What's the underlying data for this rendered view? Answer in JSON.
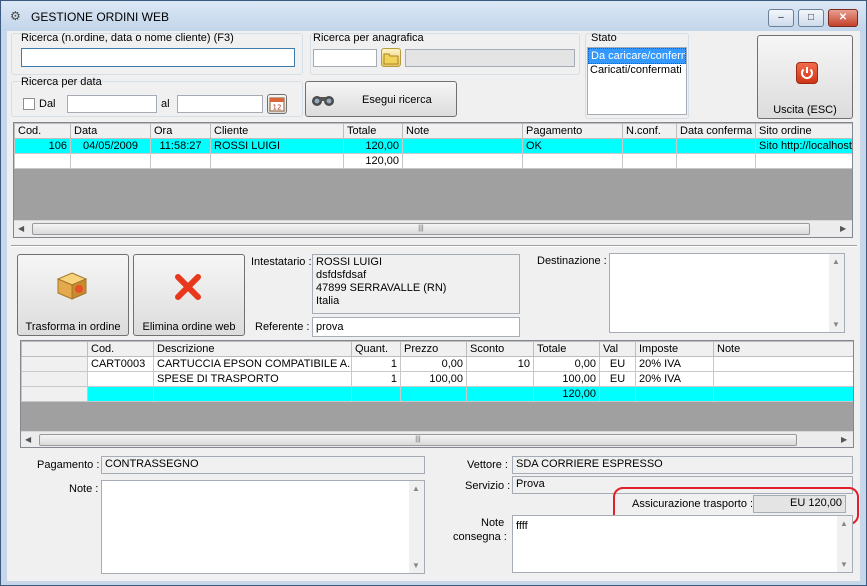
{
  "window": {
    "title": "GESTIONE ORDINI WEB",
    "minimize": "0",
    "maximize": "1",
    "close": "r"
  },
  "search": {
    "label": "Ricerca (n.ordine, data o nome cliente) (F3)",
    "value": ""
  },
  "anagrafica": {
    "label": "Ricerca per anagrafica",
    "code": "",
    "name": ""
  },
  "date_search": {
    "group_label": "Ricerca per data",
    "from_label": "Dal",
    "to_label": "al",
    "from": "",
    "to": "",
    "calendar_glyph": "12",
    "search_button": "Esegui ricerca"
  },
  "stato": {
    "label": "Stato",
    "options": [
      "Da caricare/confermare",
      "Caricati/confermati"
    ],
    "selected": "Da caricare/confermare"
  },
  "exit_button": "Uscita (ESC)",
  "orders": {
    "columns": [
      "Cod.",
      "Data",
      "Ora",
      "Cliente",
      "Totale",
      "Note",
      "Pagamento",
      "N.conf.",
      "Data conferma",
      "Sito ordine"
    ],
    "rows": [
      [
        "106",
        "04/05/2009",
        "11:58:27",
        "ROSSI LUIGI",
        "120,00",
        "",
        "OK",
        "",
        "",
        "Sito http://localhost"
      ],
      [
        "",
        "",
        "",
        "",
        "120,00",
        "",
        "",
        "",
        "",
        ""
      ]
    ]
  },
  "actions": {
    "transform": "Trasforma in ordine",
    "delete": "Elimina ordine web"
  },
  "customer": {
    "holder_label": "Intestatario :",
    "holder_lines": [
      "ROSSI LUIGI",
      "dsfdsfdsaf",
      "47899 SERRAVALLE (RN)",
      "Italia"
    ],
    "reference_label": "Referente :",
    "reference": "prova",
    "destination_label": "Destinazione :",
    "destination": ""
  },
  "lines": {
    "columns": [
      "",
      "Cod.",
      "Descrizione",
      "Quant.",
      "Prezzo",
      "Sconto",
      "Totale",
      "Val",
      "Imposte",
      "Note"
    ],
    "rows": [
      [
        "",
        "CART0003",
        "CARTUCCIA EPSON COMPATIBILE A...",
        "1",
        "0,00",
        "10",
        "0,00",
        "EU",
        "20% IVA",
        ""
      ],
      [
        "",
        "",
        "SPESE DI TRASPORTO",
        "1",
        "100,00",
        "",
        "100,00",
        "EU",
        "20% IVA",
        ""
      ],
      [
        "",
        "",
        "",
        "",
        "",
        "",
        "120,00",
        "",
        "",
        ""
      ]
    ]
  },
  "footer": {
    "payment_label": "Pagamento :",
    "payment": "CONTRASSEGNO",
    "notes_label": "Note :",
    "notes": "",
    "carrier_label": "Vettore :",
    "carrier": "SDA CORRIERE ESPRESSO",
    "service_label": "Servizio :",
    "service": "Prova",
    "insurance_label": "Assicurazione trasporto :",
    "insurance": "EU 120,00",
    "delivery_notes_label_1": "Note",
    "delivery_notes_label_2": "consegna :",
    "delivery_notes": "ffff"
  },
  "colors": {
    "selected_row": "#00ffff",
    "highlight": "#e0202a",
    "list_selection": "#3399ff"
  },
  "icons": [
    "app-icon",
    "folder-icon",
    "calendar-icon",
    "binoculars-icon",
    "power-icon",
    "box-icon",
    "delete-x-icon"
  ]
}
